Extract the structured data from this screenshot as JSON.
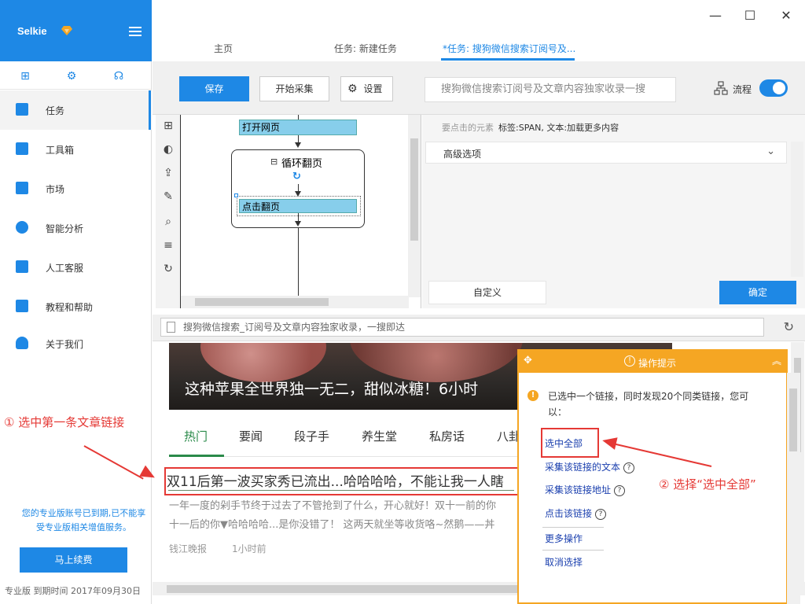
{
  "app": {
    "name": "Selkie"
  },
  "window": {
    "minimize": "—",
    "maximize": "☐",
    "close": "✕"
  },
  "tabs": [
    {
      "label": "主页"
    },
    {
      "label": "任务: 新建任务"
    },
    {
      "label": "*任务: 搜狗微信搜索订阅号及..."
    }
  ],
  "sidebar": {
    "top_icons": [
      "clipboard-plus-icon",
      "gear-icon",
      "headset-icon"
    ],
    "items": [
      {
        "label": "任务",
        "icon": "task-doc-icon",
        "active": true
      },
      {
        "label": "工具箱",
        "icon": "toolbox-icon"
      },
      {
        "label": "市场",
        "icon": "store-icon"
      },
      {
        "label": "智能分析",
        "icon": "pie-chart-icon"
      },
      {
        "label": "人工客服",
        "icon": "chat-icon"
      },
      {
        "label": "教程和帮助",
        "icon": "book-icon"
      },
      {
        "label": "关于我们",
        "icon": "user-icon"
      }
    ],
    "expire_msg": "您的专业版账号已到期,已不能享受专业版相关增值服务。",
    "renew_button": "马上续费",
    "footer": "专业版  到期时间 2017年09月30日"
  },
  "toolbar": {
    "save": "保存",
    "start": "开始采集",
    "settings": "设置",
    "search_placeholder": "搜狗微信搜索订阅号及文章内容独家收录一搜",
    "flow_label": "流程",
    "flow_toggle_on": true
  },
  "flow": {
    "open_page": "打开网页",
    "loop_label": "循环翻页",
    "loop_toggle": "⊟",
    "click_next": "点击翻页"
  },
  "properties": {
    "target_label": "要点击的元素",
    "target_value": "标签:SPAN, 文本:加载更多内容",
    "advanced": "高级选项",
    "custom": "自定义",
    "ok": "确定"
  },
  "browser": {
    "address": "搜狗微信搜索_订阅号及文章内容独家收录，一搜即达",
    "hero_caption": "这种苹果全世界独一无二，甜似冰糖！6小时",
    "nav_tabs": [
      "热门",
      "要闻",
      "段子手",
      "养生堂",
      "私房话",
      "八卦"
    ],
    "article_title": "双11后第一波买家秀已流出...哈哈哈哈，不能让我一人瞎",
    "snippet_1": "一年一度的剁手节终于过去了不管抢到了什么，开心就好！双十一前的你",
    "snippet_2": "十一后的你▼哈哈哈哈...是你没错了！ 这两天就坐等收货咯~然鹅——丼",
    "source": "钱江晚报",
    "time": "1小时前"
  },
  "tips": {
    "title": "操作提示",
    "message": "已选中一个链接，同时发现20个同类链接，您可以：",
    "select_all": "选中全部",
    "collect_text": "采集该链接的文本",
    "collect_url": "采集该链接地址",
    "click_link": "点击该链接",
    "more_actions": "更多操作",
    "cancel": "取消选择"
  },
  "annotations": {
    "step1": "① 选中第一条文章链接",
    "step2": "② 选择“选中全部”"
  }
}
